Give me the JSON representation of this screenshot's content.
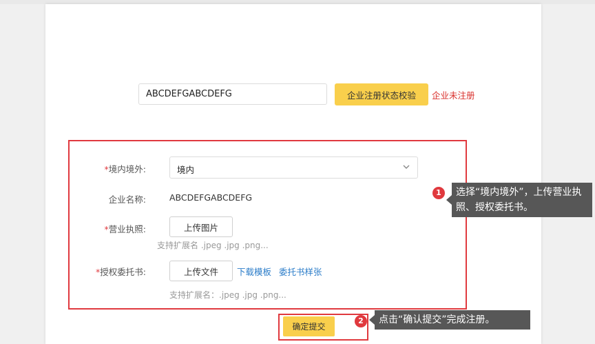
{
  "colors": {
    "accent_yellow": "#f9cf4c",
    "error_red": "#d9302c",
    "highlight_red": "#e0393e",
    "link_blue": "#2c7dc9",
    "callout_bg": "#575757"
  },
  "registration_check": {
    "code_value": "ABCDEFGABCDEFG",
    "check_button": "企业注册状态校验",
    "status": "企业未注册"
  },
  "form": {
    "region": {
      "required": "*",
      "label": "境内境外:",
      "selected": "境内",
      "icon": "chevron-down-icon"
    },
    "company_name": {
      "label": "企业名称:",
      "value": "ABCDEFGABCDEFG"
    },
    "business_license": {
      "required": "*",
      "label": "营业执照:",
      "button": "上传图片",
      "hint": "支持扩展名 .jpeg .jpg .png..."
    },
    "authorization": {
      "required": "*",
      "label": "授权委托书:",
      "button": "上传文件",
      "download_link": "下载模板",
      "sample_link": "委托书样张",
      "hint": "支持扩展名：.jpeg .jpg .png..."
    },
    "submit_button": "确定提交"
  },
  "guide": {
    "step1": {
      "badge": "1",
      "text": "选择“境内境外”，上传营业执照、授权委托书。"
    },
    "step2": {
      "badge": "2",
      "text": "点击“确认提交”完成注册。"
    }
  }
}
